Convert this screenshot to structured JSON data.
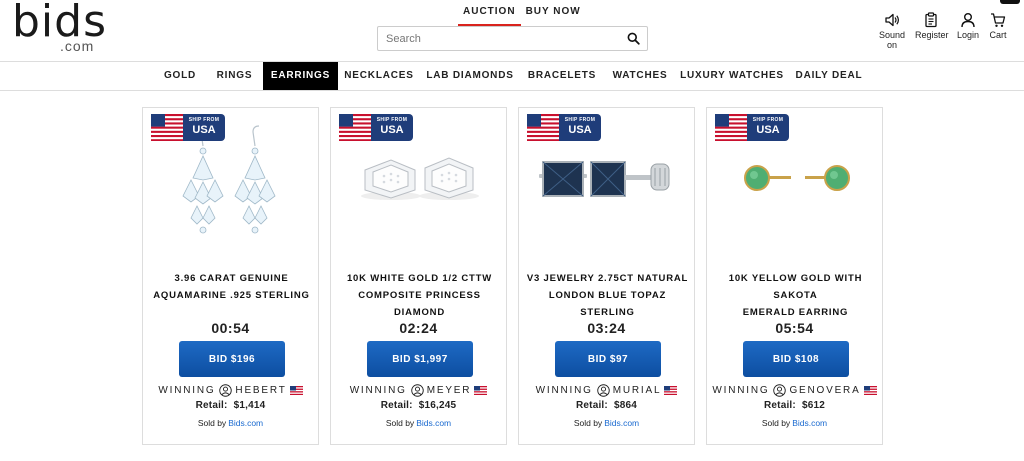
{
  "logo": {
    "main": "bids",
    "sub": ".com"
  },
  "mode_tabs": [
    {
      "label": "AUCTION",
      "active": true
    },
    {
      "label": "BUY NOW",
      "active": false
    }
  ],
  "search": {
    "placeholder": "Search",
    "value": ""
  },
  "utility": {
    "sound": "Sound on",
    "register": "Register",
    "login": "Login",
    "cart": "Cart"
  },
  "nav": [
    {
      "label": "GOLD",
      "active": false
    },
    {
      "label": "RINGS",
      "active": false
    },
    {
      "label": "EARRINGS",
      "active": true
    },
    {
      "label": "NECKLACES",
      "active": false
    },
    {
      "label": "LAB DIAMONDS",
      "active": false
    },
    {
      "label": "BRACELETS",
      "active": false
    },
    {
      "label": "WATCHES",
      "active": false
    },
    {
      "label": "LUXURY WATCHES",
      "active": false
    },
    {
      "label": "DAILY DEAL",
      "active": false
    }
  ],
  "badge": {
    "ship": "SHIP FROM",
    "country": "USA"
  },
  "labels": {
    "winning": "WINNING",
    "retail": "Retail:",
    "sold_by": "Sold by",
    "seller": "Bids.com"
  },
  "products": [
    {
      "title_line1": "3.96 CARAT GENUINE",
      "title_line2": "AQUAMARINE .925 STERLING",
      "timer": "00:54",
      "bid": "BID $196",
      "winner": "HEBERT",
      "retail": "$1,414",
      "image": "chandelier-earrings"
    },
    {
      "title_line1": "10K WHITE GOLD 1/2 CTTW",
      "title_line2": "COMPOSITE PRINCESS DIAMOND",
      "timer": "02:24",
      "bid": "BID $1,997",
      "winner": "MEYER",
      "retail": "$16,245",
      "image": "diamond-studs"
    },
    {
      "title_line1": "V3 JEWELRY 2.75CT NATURAL",
      "title_line2": "LONDON BLUE TOPAZ STERLING",
      "timer": "03:24",
      "bid": "BID $97",
      "winner": "MURIAL",
      "retail": "$864",
      "image": "topaz-studs"
    },
    {
      "title_line1": "10K YELLOW GOLD WITH SAKOTA",
      "title_line2": "EMERALD EARRING",
      "timer": "05:54",
      "bid": "BID $108",
      "winner": "GENOVERA",
      "retail": "$612",
      "image": "emerald-studs"
    }
  ],
  "colors": {
    "accent": "#d9231d",
    "bid_button": "#1560b8",
    "link": "#1a6ad0",
    "badge": "#1f3d7a"
  }
}
